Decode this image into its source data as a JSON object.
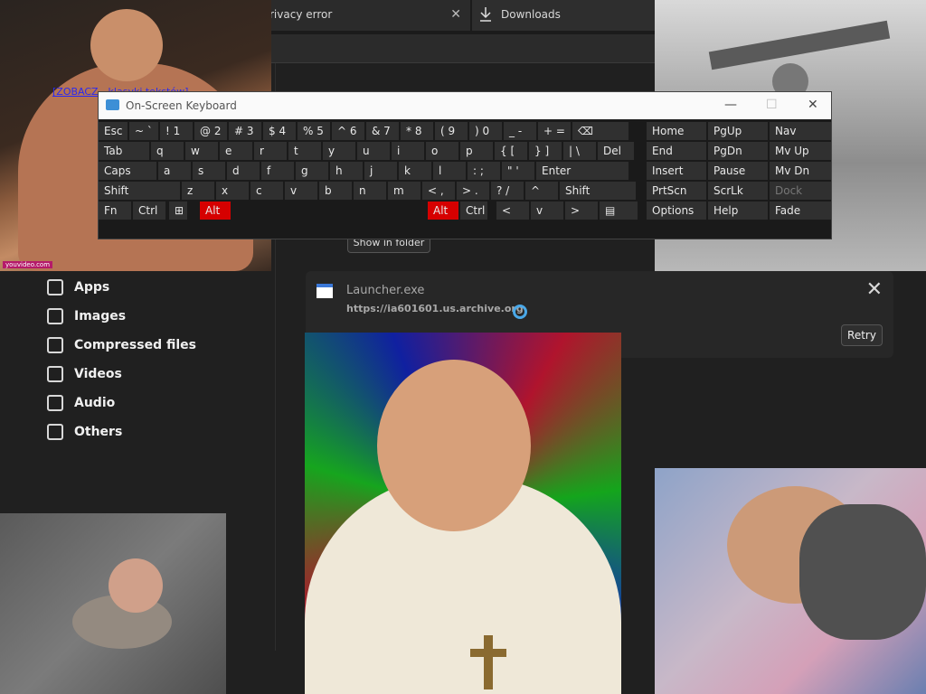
{
  "browser": {
    "tab_privacy": "rivacy error",
    "tab_downloads": "Downloads",
    "close_glyph": "✕"
  },
  "photo_tl": {
    "link_text": "[ZOBACZ - klasyki tekstów]",
    "badge": "youvideo.com"
  },
  "downloads": {
    "show_in_folder": "Show in folder",
    "sidebar": [
      {
        "label": "Apps",
        "icon": "apps-icon"
      },
      {
        "label": "Images",
        "icon": "image-icon"
      },
      {
        "label": "Compressed files",
        "icon": "archive-icon"
      },
      {
        "label": "Videos",
        "icon": "video-icon"
      },
      {
        "label": "Audio",
        "icon": "audio-icon"
      },
      {
        "label": "Others",
        "icon": "document-icon"
      }
    ],
    "item": {
      "filename": "Launcher.exe",
      "url": "https://ia601601.us.archive.org",
      "retry": "Retry",
      "close": "✕"
    }
  },
  "osk": {
    "title": "On-Screen Keyboard",
    "minimize": "—",
    "maximize": "☐",
    "close": "✕",
    "rows": {
      "r1": [
        "Esc",
        "~ `",
        "! 1",
        "@ 2",
        "# 3",
        "$ 4",
        "% 5",
        "^ 6",
        "& 7",
        "* 8",
        "( 9",
        ") 0",
        "_ -",
        "+ =",
        "⌫"
      ],
      "r2": [
        "Tab",
        "q",
        "w",
        "e",
        "r",
        "t",
        "y",
        "u",
        "i",
        "o",
        "p",
        "{ [",
        "} ]",
        "| \\",
        "Del"
      ],
      "r3": [
        "Caps",
        "a",
        "s",
        "d",
        "f",
        "g",
        "h",
        "j",
        "k",
        "l",
        ": ;",
        "\" '",
        "Enter"
      ],
      "r4": [
        "Shift",
        "z",
        "x",
        "c",
        "v",
        "b",
        "n",
        "m",
        "< ,",
        "> .",
        "? /",
        "^",
        "Shift"
      ],
      "r5": [
        "Fn",
        "Ctrl",
        "⊞",
        "Alt",
        "Alt",
        "Ctrl",
        "<",
        "v",
        ">",
        "▤"
      ]
    },
    "nav": [
      [
        "Home",
        "PgUp",
        "Nav"
      ],
      [
        "End",
        "PgDn",
        "Mv Up"
      ],
      [
        "Insert",
        "Pause",
        "Mv Dn"
      ],
      [
        "PrtScn",
        "ScrLk",
        "Dock"
      ],
      [
        "Options",
        "Help",
        "Fade"
      ]
    ]
  }
}
